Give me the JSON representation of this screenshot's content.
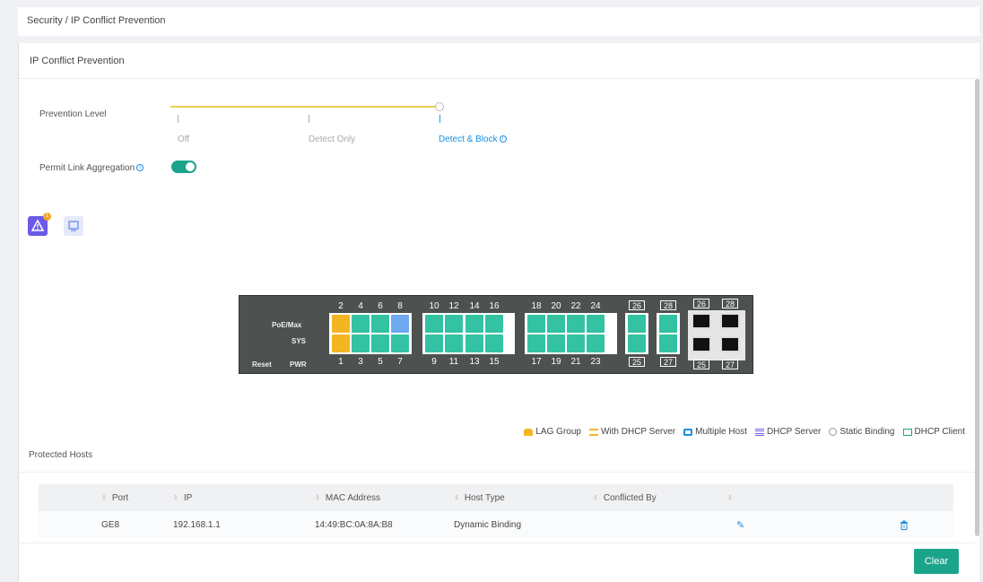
{
  "breadcrumb": {
    "root": "Security",
    "separator": " / ",
    "current": "IP Conflict Prevention"
  },
  "card": {
    "title": "IP Conflict Prevention"
  },
  "prevention": {
    "label": "Prevention Level",
    "levels": [
      "Off",
      "Detect Only",
      "Detect & Block"
    ],
    "selected": "Detect & Block",
    "selected_fraction": 1.0
  },
  "permit_link": {
    "label": "Permit Link Aggregation",
    "enabled": true
  },
  "views": {
    "warning_count": "1"
  },
  "panel": {
    "labels": {
      "poe": "PoE/Max",
      "sys": "SYS",
      "pwr": "PWR",
      "reset": "Reset"
    },
    "top_numbers": [
      "2",
      "4",
      "6",
      "8",
      "10",
      "12",
      "14",
      "16",
      "18",
      "20",
      "22",
      "24"
    ],
    "bottom_numbers": [
      "1",
      "3",
      "5",
      "7",
      "9",
      "11",
      "13",
      "15",
      "17",
      "19",
      "21",
      "23"
    ],
    "combo_top": [
      "26",
      "28"
    ],
    "combo_bottom": [
      "25",
      "27"
    ],
    "sfp_top": [
      "26",
      "28"
    ],
    "sfp_bottom": [
      "25",
      "27"
    ]
  },
  "legend": [
    {
      "label": "LAG Group",
      "color": "#f4b523"
    },
    {
      "label": "With DHCP Server",
      "color": "#f4b523"
    },
    {
      "label": "Multiple Host",
      "color": "#1a8ee0"
    },
    {
      "label": "DHCP Server",
      "color": "#6b5be6"
    },
    {
      "label": "Static Binding",
      "color": "#999999"
    },
    {
      "label": "DHCP Client",
      "color": "#1aa58b"
    }
  ],
  "protected_hosts": {
    "title": "Protected Hosts",
    "columns": [
      "Port",
      "IP",
      "MAC Address",
      "Host Type",
      "Conflicted By"
    ],
    "rows": [
      {
        "port": "GE8",
        "ip": "192.168.1.1",
        "mac": "14:49:BC:0A:8A:B8",
        "host_type": "Dynamic Binding",
        "conflicted_by": ""
      }
    ]
  },
  "actions": {
    "clear": "Clear"
  },
  "colors": {
    "accent": "#1aa58b",
    "link": "#1a8ee0",
    "lag": "#f4b523",
    "port": "#33c2a2"
  }
}
